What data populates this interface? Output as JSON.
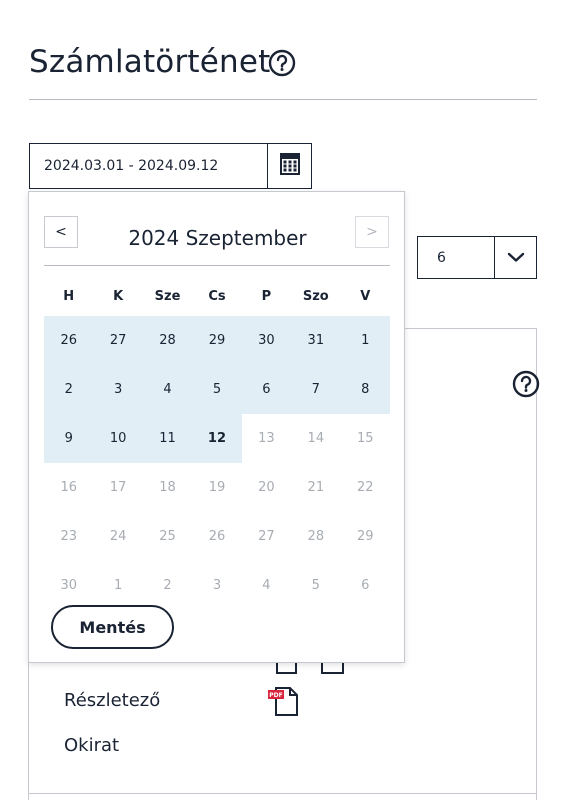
{
  "page": {
    "title": "Számlatörténet"
  },
  "date_filter": {
    "range_text": "2024.03.01 - 2024.09.12"
  },
  "count_select": {
    "value": "6"
  },
  "calendar": {
    "month_label": "2024 Szeptember",
    "prev_label": "<",
    "next_label": ">",
    "weekdays": [
      "H",
      "K",
      "Sze",
      "Cs",
      "P",
      "Szo",
      "V"
    ],
    "weeks": [
      [
        "26",
        "27",
        "28",
        "29",
        "30",
        "31",
        "1"
      ],
      [
        "2",
        "3",
        "4",
        "5",
        "6",
        "7",
        "8"
      ],
      [
        "9",
        "10",
        "11",
        "12",
        "13",
        "14",
        "15"
      ],
      [
        "16",
        "17",
        "18",
        "19",
        "20",
        "21",
        "22"
      ],
      [
        "23",
        "24",
        "25",
        "26",
        "27",
        "28",
        "29"
      ],
      [
        "30",
        "1",
        "2",
        "3",
        "4",
        "5",
        "6"
      ]
    ],
    "save_label": "Mentés"
  },
  "details": {
    "rows": [
      {
        "label": "Részletező",
        "icon": "pdf-file-icon"
      },
      {
        "label": "Okirat"
      }
    ]
  },
  "colors": {
    "text": "#1a2333",
    "range_highlight": "#e1eef6",
    "muted": "#a8adb3",
    "border": "#c6cad0",
    "pdf_red": "#d9263c"
  }
}
